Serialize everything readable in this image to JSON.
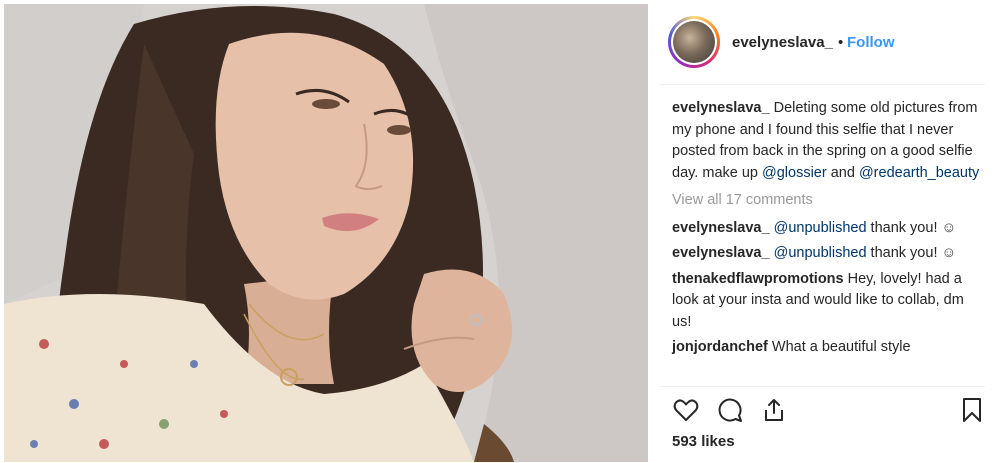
{
  "post": {
    "username": "evelyneslava_",
    "separator": "•",
    "follow_label": "Follow",
    "caption": {
      "user": "evelyneslava_",
      "text_before": " Deleting some old pictures from my phone and I found this selfie that I never posted from back in the spring on a good selfie day. make up ",
      "mention1": "@glossier",
      "text_mid": " and ",
      "mention2": "@redearth_beauty"
    },
    "view_all": "View all 17 comments",
    "comments": [
      {
        "user": "evelyneslava_",
        "mention": "@unpublished",
        "text": " thank you! ☺"
      },
      {
        "user": "evelyneslava_",
        "mention": "@unpublished",
        "text": " thank you! ☺"
      },
      {
        "user": "thenakedflawpromotions",
        "mention": "",
        "text": " Hey, lovely! had a look at your insta and would like to collab, dm us!"
      },
      {
        "user": "jonjordanchef",
        "mention": "",
        "text": " What a beautiful style"
      }
    ],
    "likes": "593 likes",
    "icons": [
      "heart-icon",
      "comment-icon",
      "share-icon",
      "bookmark-icon"
    ]
  }
}
